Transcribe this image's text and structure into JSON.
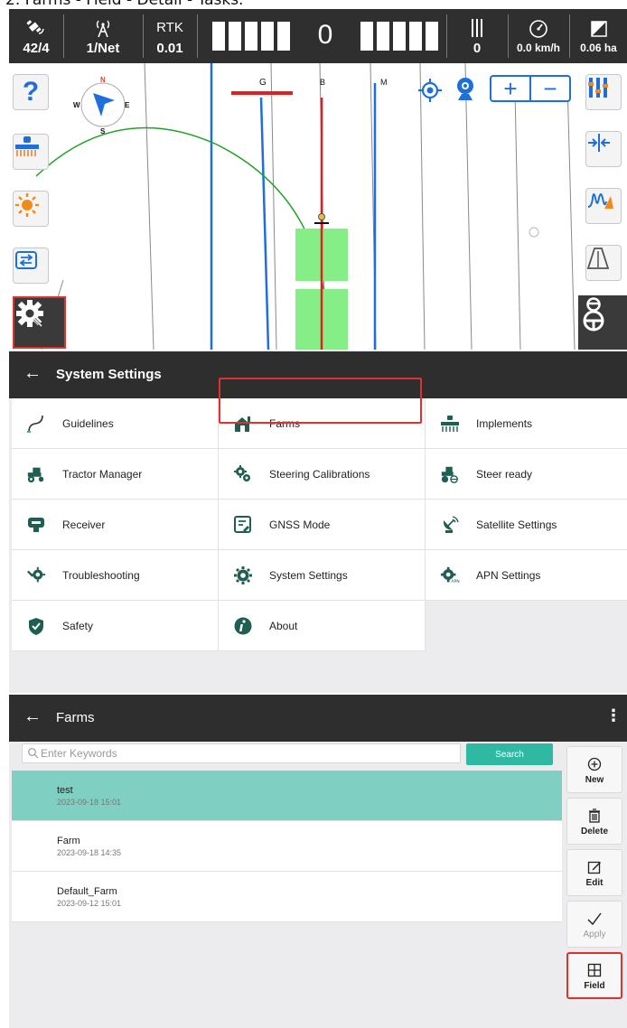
{
  "caption": "2. Farms - Field - Detail - Tasks.",
  "status_bar": {
    "satellites": "42/4",
    "correction": "1/Net",
    "rtk_label": "RTK",
    "rtk_value": "0.01",
    "offset": "0",
    "counter": "0",
    "speed": "0.0 km/h",
    "area": "0.06 ha"
  },
  "map": {
    "compass": {
      "n": "N",
      "s": "S",
      "e": "E",
      "w": "W"
    },
    "line_labels": {
      "g": "G",
      "b": "B",
      "m": "M"
    },
    "zoom_in": "+",
    "zoom_out": "−",
    "help": "?"
  },
  "settings": {
    "title": "System Settings",
    "items": [
      {
        "label": "Guidelines"
      },
      {
        "label": "Farms"
      },
      {
        "label": "Implements"
      },
      {
        "label": "Tractor Manager"
      },
      {
        "label": "Steering Calibrations"
      },
      {
        "label": "Steer ready"
      },
      {
        "label": "Receiver"
      },
      {
        "label": "GNSS Mode"
      },
      {
        "label": "Satellite Settings"
      },
      {
        "label": "Troubleshooting"
      },
      {
        "label": "System Settings"
      },
      {
        "label": "APN Settings"
      },
      {
        "label": "Safety"
      },
      {
        "label": "About"
      }
    ]
  },
  "farms": {
    "title": "Farms",
    "search_placeholder": "Enter Keywords",
    "search_label": "Search",
    "rows": [
      {
        "name": "test",
        "date": "2023-09-18 15:01"
      },
      {
        "name": "Farm",
        "date": "2023-09-18 14:35"
      },
      {
        "name": "Default_Farm",
        "date": "2023-09-12 15:01"
      }
    ],
    "actions": {
      "new": "New",
      "delete": "Delete",
      "edit": "Edit",
      "apply": "Apply",
      "field": "Field"
    }
  },
  "colors": {
    "accent_red": "#e03030",
    "teal": "#2fb9a2",
    "selected_row": "#7fd0c2",
    "guide_blue": "#1e6fd9",
    "dark_bar": "#2e2e2e"
  }
}
